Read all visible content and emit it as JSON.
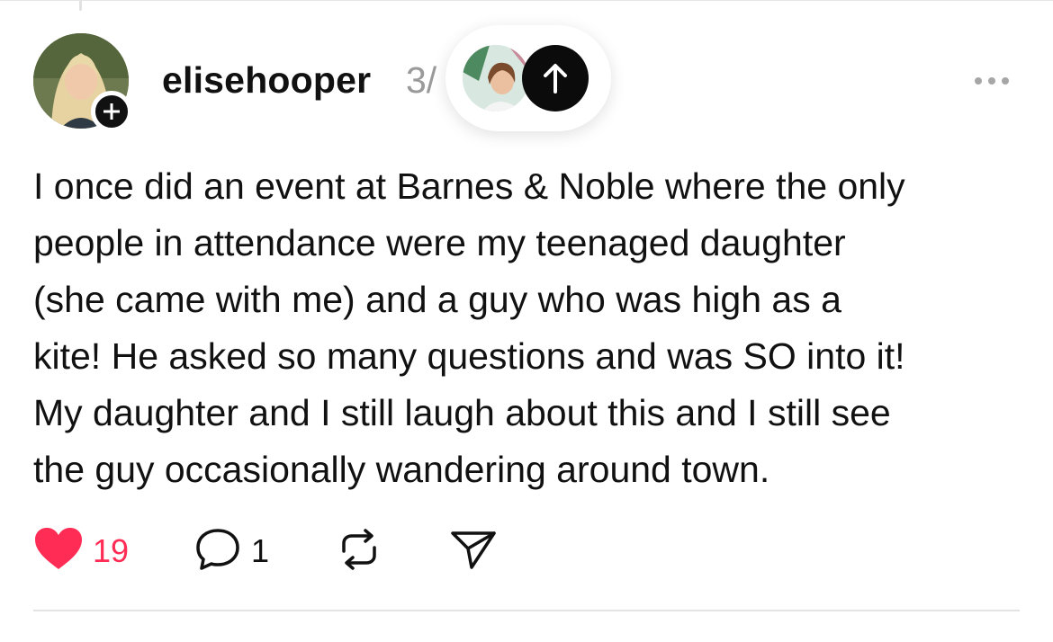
{
  "post": {
    "author": {
      "username": "elisehooper",
      "avatar_icon": "user-avatar",
      "follow_icon": "plus-icon"
    },
    "timestamp_partial": "3/",
    "floating_pill": {
      "avatar_icon": "user-avatar",
      "arrow_icon": "arrow-up-icon"
    },
    "more_icon": "more-options-icon",
    "text_lines": [
      "I once did an event at Barnes & Noble where the only",
      "people in attendance were my teenaged daughter",
      "(she came with me) and a guy who was high as a",
      "kite! He asked so many questions and was SO into it!",
      "My daughter and I still laugh about this and I still see",
      "the guy occasionally wandering around town."
    ],
    "actions": {
      "like_count": "19",
      "reply_count": "1",
      "like_icon": "heart-icon",
      "reply_icon": "comment-icon",
      "repost_icon": "repost-icon",
      "share_icon": "send-icon"
    }
  },
  "colors": {
    "like_active": "#ff2d55",
    "text": "#111111",
    "muted": "#9a9a9a"
  }
}
